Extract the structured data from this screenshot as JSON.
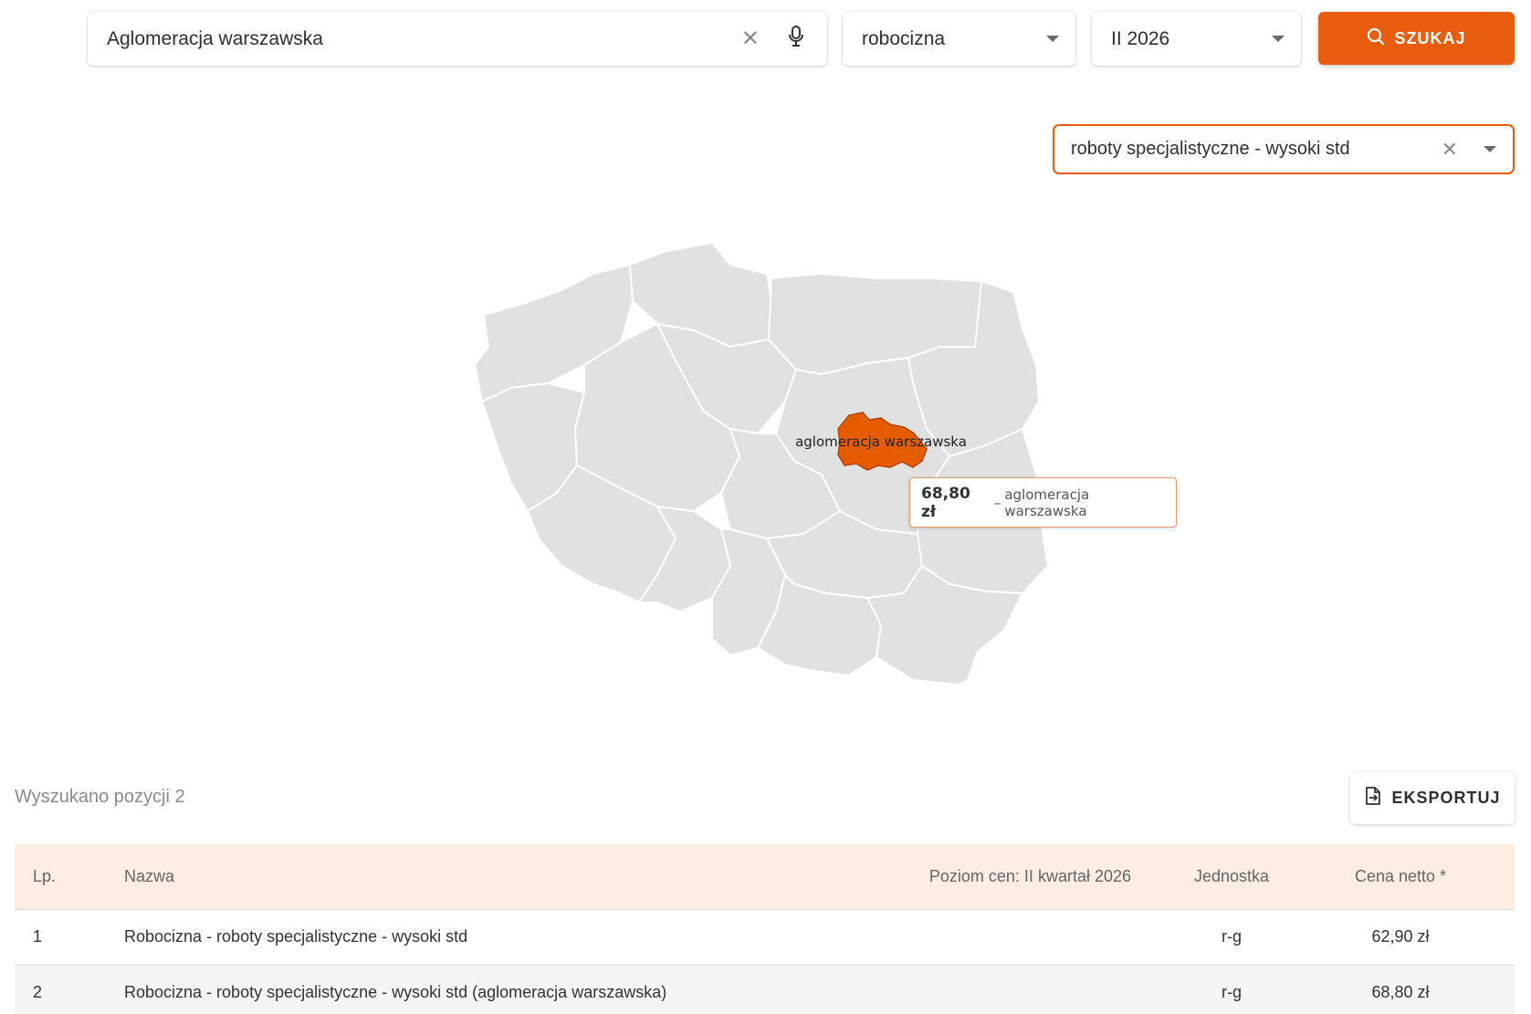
{
  "search": {
    "value": "Aglomeracja warszawska",
    "clear_icon": "close-icon",
    "mic_icon": "microphone-icon"
  },
  "category": {
    "selected": "robocizna"
  },
  "period": {
    "selected": "II 2026"
  },
  "search_button": {
    "label": "SZUKAJ",
    "icon": "search-icon"
  },
  "subcategory": {
    "selected": "roboty specjalistyczne - wysoki std"
  },
  "map": {
    "highlighted_region": "aglomeracja warszawska",
    "highlight_color": "#e65c00",
    "region_color": "#e1e1e1",
    "tooltip": {
      "price": "68,80 zł",
      "separator": "–",
      "region": "aglomeracja warszawska"
    }
  },
  "results": {
    "count_label": "Wyszukano pozycji 2",
    "export_label": "EKSPORTUJ",
    "columns": {
      "lp": "Lp.",
      "name": "Nazwa",
      "level": "Poziom cen: II kwartał 2026",
      "unit": "Jednostka",
      "price": "Cena netto *"
    },
    "rows": [
      {
        "lp": "1",
        "name": "Robocizna - roboty specjalistyczne - wysoki std",
        "unit": "r-g",
        "price": "62,90 zł"
      },
      {
        "lp": "2",
        "name": "Robocizna - roboty specjalistyczne - wysoki std (aglomeracja warszawska)",
        "unit": "r-g",
        "price": "68,80 zł"
      }
    ]
  },
  "colors": {
    "accent": "#e85c0d",
    "header_bg": "#fdede2"
  }
}
